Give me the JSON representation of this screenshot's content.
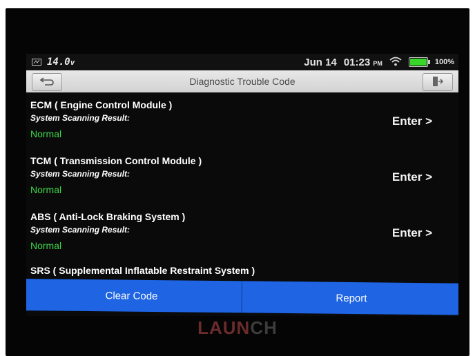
{
  "status_bar": {
    "voltage": "14.0",
    "voltage_unit": "v",
    "date": "Jun 14",
    "time": "01:23",
    "ampm": "PM",
    "battery_percent": "100%",
    "battery_level": 1.0
  },
  "title_bar": {
    "title": "Diagnostic Trouble Code"
  },
  "systems": [
    {
      "name": "ECM ( Engine Control Module )",
      "scan_label": "System Scanning Result:",
      "status": "Normal",
      "enter_label": "Enter >"
    },
    {
      "name": "TCM ( Transmission Control Module )",
      "scan_label": "System Scanning Result:",
      "status": "Normal",
      "enter_label": "Enter >"
    },
    {
      "name": "ABS ( Anti-Lock Braking System )",
      "scan_label": "System Scanning Result:",
      "status": "Normal",
      "enter_label": "Enter >"
    }
  ],
  "partial_row": {
    "name": "SRS ( Supplemental Inflatable Restraint System )"
  },
  "bottom_bar": {
    "clear_code_label": "Clear Code",
    "report_label": "Report"
  },
  "brand": {
    "part_a": "LAUN",
    "part_b": "CH"
  },
  "colors": {
    "accent_blue": "#1e64e3",
    "status_green": "#3fd84a",
    "battery_green": "#39d62a"
  }
}
